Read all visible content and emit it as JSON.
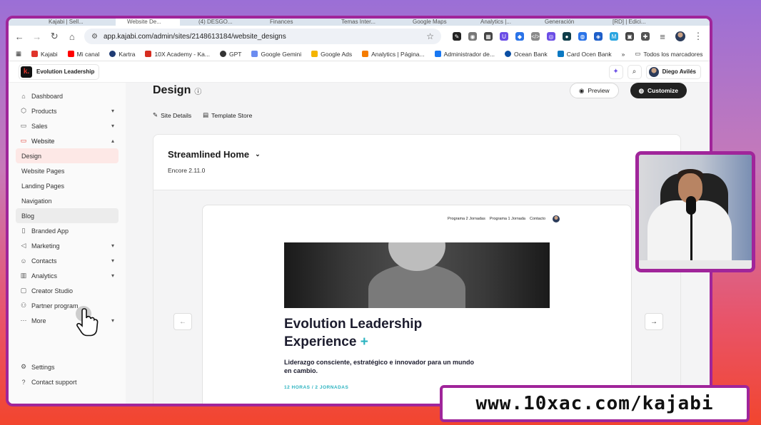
{
  "browser": {
    "tabs": [
      "Kajabi | Sell...",
      "Website De...",
      "(4) DESGO...",
      "Finances",
      "Temas Inter...",
      "Google Maps",
      "Analytics |...",
      "Generación",
      "[RD] | Edici..."
    ],
    "url": "app.kajabi.com/admin/sites/2148613184/website_designs",
    "bookmarks": [
      "Kajabi",
      "Mi canal",
      "Kartra",
      "10X Academy - Ka...",
      "GPT",
      "Google Gemini",
      "Google Ads",
      "Analytics | Página...",
      "Administrador de...",
      "Ocean Bank",
      "Card Ocen Bank"
    ],
    "bookmarks_overflow": "»",
    "all_bookmarks": "Todos los marcadores",
    "extension_colors": [
      "#222222",
      "#777777",
      "#444444",
      "#6b4de6",
      "#2a73e8",
      "#8a8a8a",
      "#6b4de6",
      "#0f3d4a",
      "#2a73e8",
      "#1d5ec9",
      "#2aa5e0",
      "#444444",
      "#555555"
    ]
  },
  "app": {
    "brand": "Evolution Leadership",
    "brand_logo": "k.",
    "user_name": "Diego Avilés"
  },
  "sidebar": {
    "items": [
      {
        "label": "Dashboard",
        "icon": "home-icon"
      },
      {
        "label": "Products",
        "icon": "box-icon",
        "chevron": "▾"
      },
      {
        "label": "Sales",
        "icon": "wallet-icon",
        "chevron": "▾"
      },
      {
        "label": "Website",
        "icon": "monitor-icon",
        "chevron": "▴"
      }
    ],
    "website_sub": [
      "Design",
      "Website Pages",
      "Landing Pages",
      "Navigation",
      "Blog"
    ],
    "items_after": [
      {
        "label": "Branded App",
        "icon": "phone-icon"
      },
      {
        "label": "Marketing",
        "icon": "megaphone-icon",
        "chevron": "▾"
      },
      {
        "label": "Contacts",
        "icon": "contacts-icon",
        "chevron": "▾"
      },
      {
        "label": "Analytics",
        "icon": "analytics-icon",
        "chevron": "▾"
      },
      {
        "label": "Creator Studio",
        "icon": "studio-icon"
      },
      {
        "label": "Partner program",
        "icon": "partner-icon"
      },
      {
        "label": "More",
        "icon": "more-icon",
        "chevron": "▾"
      }
    ],
    "settings": "Settings",
    "support": "Contact support"
  },
  "main": {
    "title": "Design",
    "preview_label": "Preview",
    "customize_label": "Customize",
    "site_details": "Site Details",
    "template_store": "Template Store",
    "theme": {
      "name": "Streamlined Home",
      "version": "Encore 2.11.0"
    },
    "site_preview": {
      "nav": [
        "Programa 2 Jornadas",
        "Programa 1 Jornada",
        "Contacto"
      ],
      "title_line1": "Evolution Leadership",
      "title_line2": "Experience",
      "title_plus": "+",
      "subtitle": "Liderazgo consciente, estratégico e innovador para un mundo en cambio.",
      "meta": "12 HORAS / 2 JORNADAS"
    }
  },
  "overlay": {
    "url_banner": "www.10xac.com/kajabi"
  }
}
